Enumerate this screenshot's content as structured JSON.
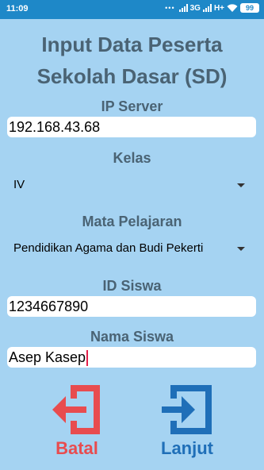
{
  "status_bar": {
    "time": "11:09",
    "dots": "•••",
    "network": "3G",
    "network2": "H+",
    "battery": "99"
  },
  "title_line1": "Input Data Peserta",
  "title_line2": "Sekolah Dasar (SD)",
  "ip_server": {
    "label": "IP Server",
    "value": "192.168.43.68"
  },
  "kelas": {
    "label": "Kelas",
    "selected": "IV"
  },
  "mata_pelajaran": {
    "label": "Mata Pelajaran",
    "selected": "Pendidikan Agama dan Budi Pekerti"
  },
  "id_siswa": {
    "label": "ID Siswa",
    "value": "1234667890"
  },
  "nama_siswa": {
    "label": "Nama Siswa",
    "value": "Asep Kasep"
  },
  "buttons": {
    "batal": {
      "label": "Batal",
      "color": "#e84c4f",
      "icon": "exit-arrow-icon"
    },
    "lanjut": {
      "label": "Lanjut",
      "color": "#1f6fb8",
      "icon": "enter-arrow-icon"
    }
  }
}
